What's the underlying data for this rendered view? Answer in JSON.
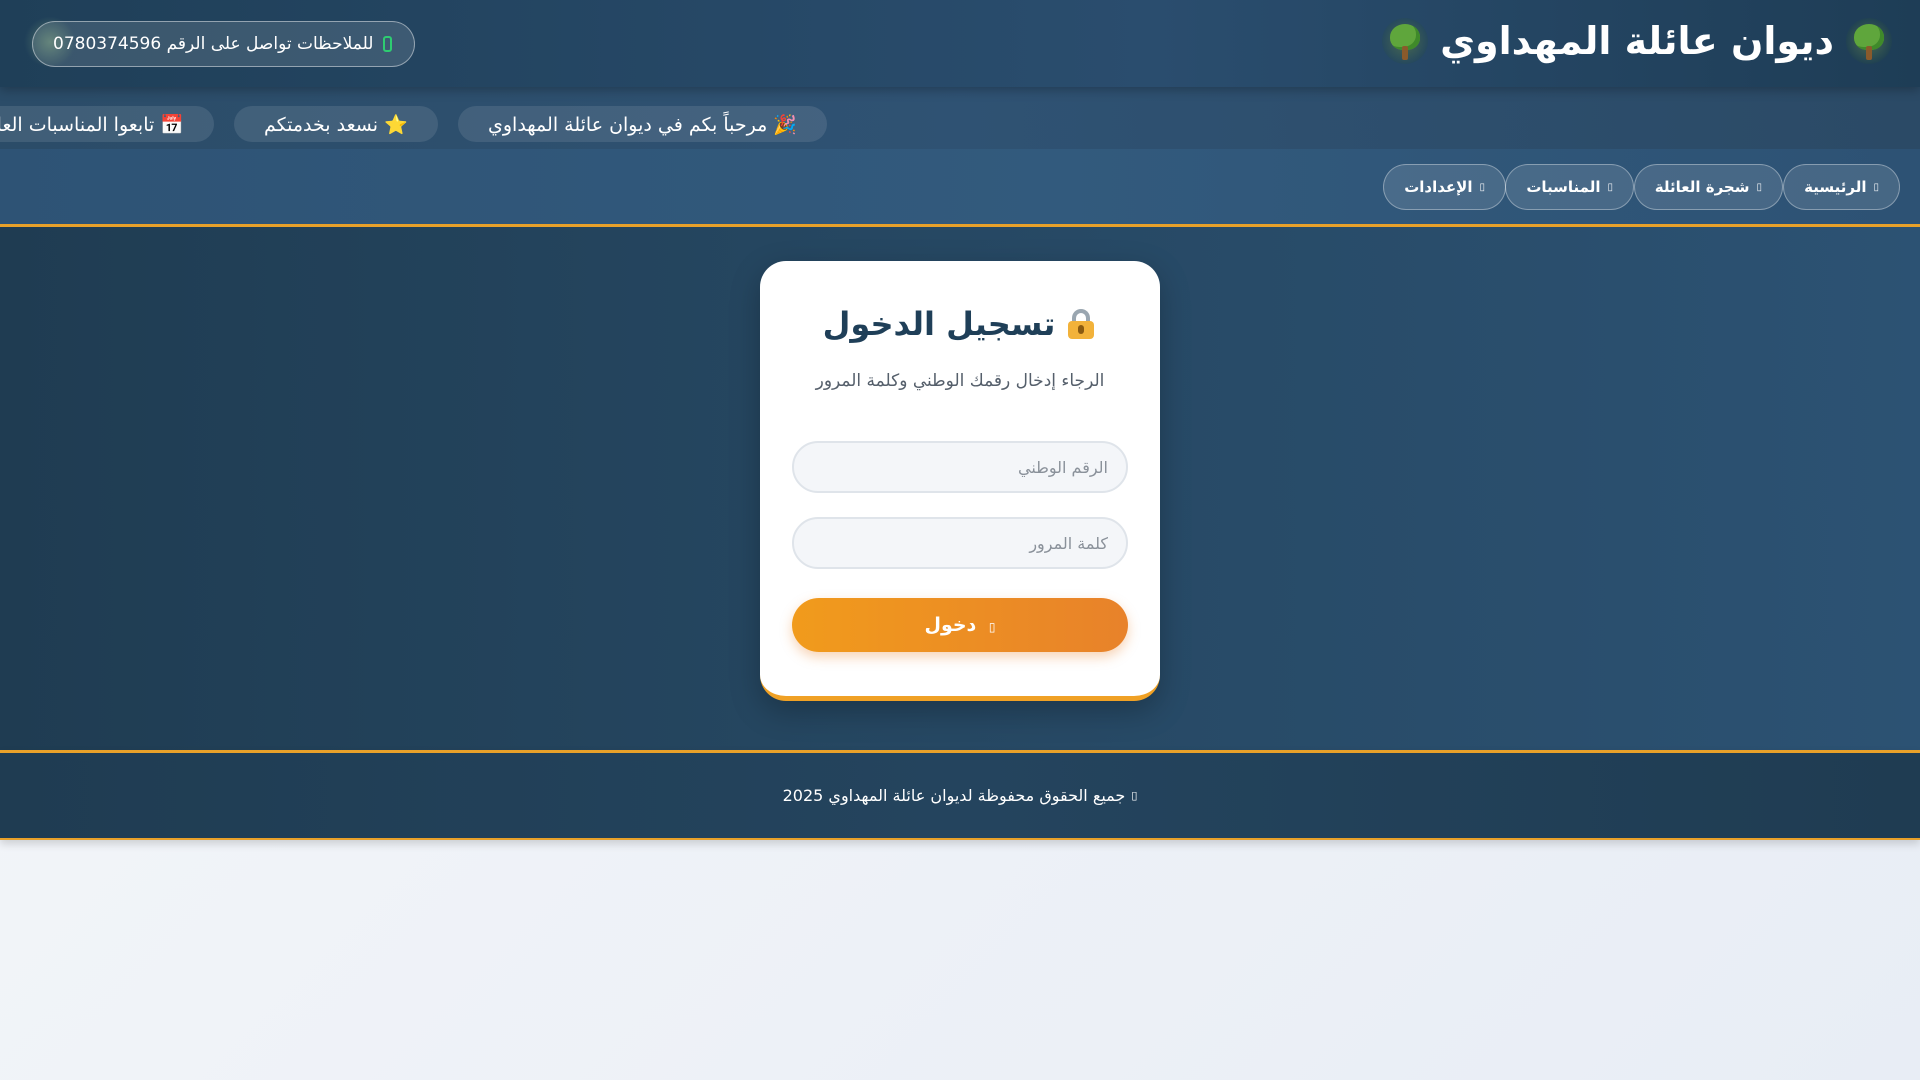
{
  "header": {
    "title": "ديوان عائلة المهداوي",
    "contact": {
      "text": "للملاحظات تواصل على الرقم 0780374596",
      "icon": "whatsapp-icon"
    }
  },
  "ticker": {
    "items": [
      "🎉 مرحباً بكم في ديوان عائلة المهداوي",
      "⭐ نسعد بخدمتكم",
      "📅 تابعوا المناسبات العائلية"
    ]
  },
  "nav": {
    "items": [
      {
        "label": "الرئيسية",
        "icon": "home-icon"
      },
      {
        "label": "شجرة العائلة",
        "icon": "tree-icon"
      },
      {
        "label": "المناسبات",
        "icon": "calendar-icon"
      },
      {
        "label": "الإعدادات",
        "icon": "gear-icon"
      }
    ]
  },
  "login": {
    "title": "تسجيل الدخول",
    "subtitle": "الرجاء إدخال رقمك الوطني وكلمة المرور",
    "national_id_placeholder": "الرقم الوطني",
    "password_placeholder": "كلمة المرور",
    "submit_label": "دخول"
  },
  "footer": {
    "text": "جميع الحقوق محفوظة لديوان عائلة المهداوي 2025"
  },
  "colors": {
    "primary": "#1f3f58",
    "accent": "#f0a125",
    "button_gradient_start": "#f19b1c",
    "button_gradient_end": "#e8822a"
  }
}
